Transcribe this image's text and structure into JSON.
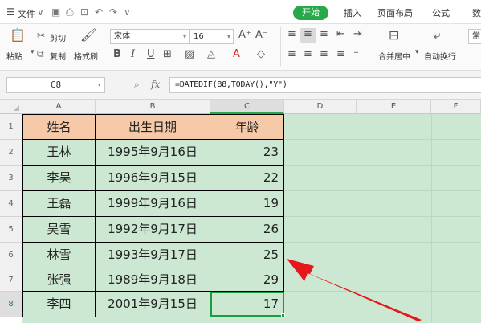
{
  "menubar": {
    "file_label": "文件",
    "tabs": [
      "开始",
      "插入",
      "页面布局",
      "公式",
      "数"
    ]
  },
  "toolbar": {
    "paste": "粘贴",
    "cut": "剪切",
    "copy": "复制",
    "format_painter": "格式刷",
    "font_name": "宋体",
    "font_size": "16",
    "merge_center": "合并居中",
    "auto_wrap": "自动换行",
    "number_format": "常"
  },
  "formula_bar": {
    "name_box": "C8",
    "fx": "fx",
    "formula": "=DATEDIF(B8,TODAY(),\"Y\")"
  },
  "columns": [
    "A",
    "B",
    "C",
    "D",
    "E",
    "F"
  ],
  "rows": [
    "1",
    "2",
    "3",
    "4",
    "5",
    "6",
    "7",
    "8"
  ],
  "table": {
    "headers": [
      "姓名",
      "出生日期",
      "年龄"
    ],
    "rows": [
      [
        "王林",
        "1995年9月16日",
        "23"
      ],
      [
        "李昊",
        "1996年9月15日",
        "22"
      ],
      [
        "王磊",
        "1999年9月16日",
        "19"
      ],
      [
        "吴雪",
        "1992年9月17日",
        "26"
      ],
      [
        "林雪",
        "1993年9月17日",
        "25"
      ],
      [
        "张强",
        "1989年9月18日",
        "29"
      ],
      [
        "李四",
        "2001年9月15日",
        "17"
      ]
    ]
  },
  "selection": {
    "cell": "C8"
  },
  "colors": {
    "accent": "#29a84a",
    "header_fill": "#f6c9a8",
    "sheet_fill": "#cde8d2",
    "annotation_arrow": "#e8151b"
  }
}
